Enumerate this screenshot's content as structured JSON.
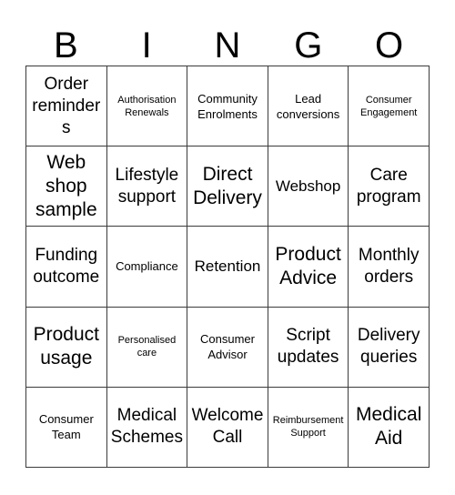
{
  "card": {
    "title": "BINGO",
    "header_letters": [
      "B",
      "I",
      "N",
      "G",
      "O"
    ],
    "columns": 5,
    "rows": 5,
    "text_color": "#000000",
    "border_color": "#3b3b3b",
    "background_color": "#ffffff"
  },
  "cells": [
    {
      "text": "Order reminders",
      "size": "lg"
    },
    {
      "text": "Authorisation Renewals",
      "size": "xs"
    },
    {
      "text": "Community Enrolments",
      "size": "sm"
    },
    {
      "text": "Lead conversions",
      "size": "sm"
    },
    {
      "text": "Consumer Engagement",
      "size": "xs"
    },
    {
      "text": "Web shop sample",
      "size": "xl"
    },
    {
      "text": "Lifestyle support",
      "size": "lg"
    },
    {
      "text": "Direct Delivery",
      "size": "xl"
    },
    {
      "text": "Webshop",
      "size": "md"
    },
    {
      "text": "Care program",
      "size": "lg"
    },
    {
      "text": "Funding outcome",
      "size": "lg"
    },
    {
      "text": "Compliance",
      "size": "sm"
    },
    {
      "text": "Retention",
      "size": "md"
    },
    {
      "text": "Product Advice",
      "size": "xl"
    },
    {
      "text": "Monthly orders",
      "size": "lg"
    },
    {
      "text": "Product usage",
      "size": "xl"
    },
    {
      "text": "Personalised care",
      "size": "xs"
    },
    {
      "text": "Consumer Advisor",
      "size": "sm"
    },
    {
      "text": "Script updates",
      "size": "lg"
    },
    {
      "text": "Delivery queries",
      "size": "lg"
    },
    {
      "text": "Consumer Team",
      "size": "sm"
    },
    {
      "text": "Medical Schemes",
      "size": "lg"
    },
    {
      "text": "Welcome Call",
      "size": "lg"
    },
    {
      "text": "Reimbursement Support",
      "size": "xs"
    },
    {
      "text": "Medical Aid",
      "size": "xl"
    }
  ]
}
